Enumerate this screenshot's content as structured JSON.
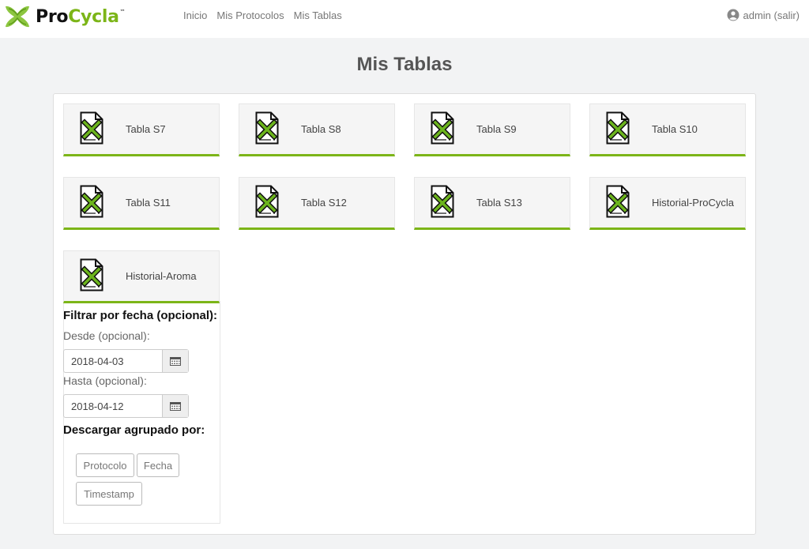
{
  "brand": {
    "pro": "Pro",
    "cycla": "Cycla",
    "tm": "™",
    "accent": "#7cb518"
  },
  "nav": {
    "items": [
      {
        "label": "Inicio"
      },
      {
        "label": "Mis Protocolos"
      },
      {
        "label": "Mis Tablas"
      }
    ]
  },
  "user": {
    "label": "admin (salir)",
    "icon": "user-circle-icon"
  },
  "page": {
    "title": "Mis Tablas"
  },
  "tables": [
    {
      "label": "Tabla S7",
      "icon": "excel-file-icon"
    },
    {
      "label": "Tabla S8",
      "icon": "excel-file-icon"
    },
    {
      "label": "Tabla S9",
      "icon": "excel-file-icon"
    },
    {
      "label": "Tabla S10",
      "icon": "excel-file-icon"
    },
    {
      "label": "Tabla S11",
      "icon": "excel-file-icon"
    },
    {
      "label": "Tabla S12",
      "icon": "excel-file-icon"
    },
    {
      "label": "Tabla S13",
      "icon": "excel-file-icon"
    },
    {
      "label": "Historial-ProCycla",
      "icon": "excel-file-icon"
    },
    {
      "label": "Historial-Aroma",
      "icon": "excel-file-icon"
    }
  ],
  "filter": {
    "title": "Filtrar por fecha (opcional):",
    "desde_label": "Desde (opcional):",
    "desde_value": "2018-04-03",
    "hasta_label": "Hasta (opcional):",
    "hasta_value": "2018-04-12",
    "group_title": "Descargar agrupado por:",
    "buttons": {
      "protocolo": "Protocolo",
      "fecha": "Fecha",
      "timestamp": "Timestamp"
    }
  }
}
